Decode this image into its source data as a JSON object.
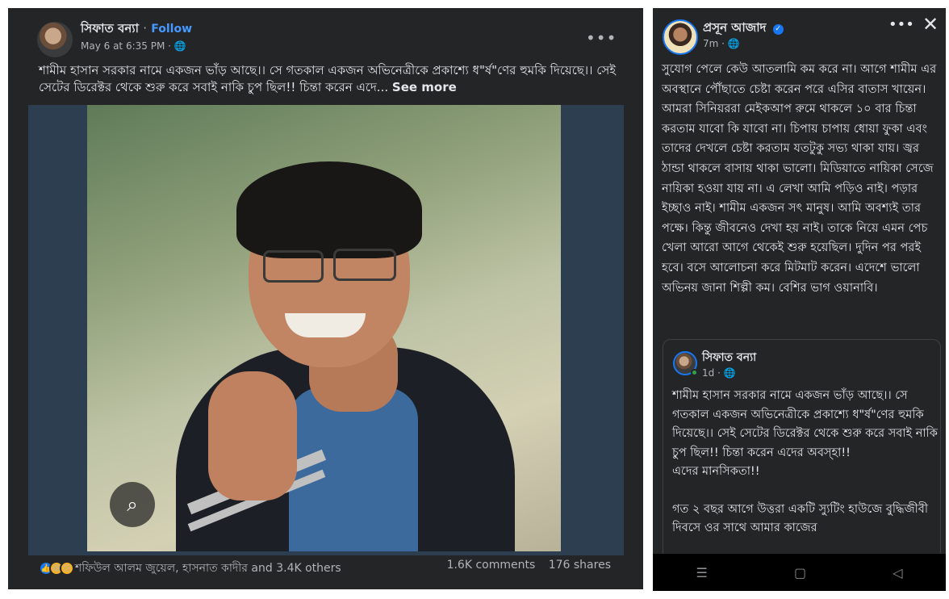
{
  "left_post": {
    "author": "সিফাত বন্যা",
    "separator": "·",
    "follow_label": "Follow",
    "timestamp": "May 6 at 6:35 PM",
    "audience_icon": "globe-icon",
    "menu_icon": "more-dots-icon",
    "menu_glyph": "•••",
    "text": "শামীম হাসান সরকার নামে একজন ভাঁড় আছে।। সে গতকাল একজন অভিনেত্রীকে প্রকাশ্যে ধ\"র্ষ\"ণের হুমকি দিয়েছে।। সেই সেটের ডিরেক্টর থেকে শুরু করে সবাই নাকি চুপ ছিল!! চিন্তা করেন এদে...",
    "see_more_label": "See more",
    "lens_icon": "lens-icon",
    "reaction_icons": [
      "like-icon",
      "haha-icon",
      "sad-icon"
    ],
    "reactions_text": "শফিউল আলম জুয়েল, হাসনাত কাদীর and 3.4K others",
    "comments_text": "1.6K comments",
    "shares_text": "176 shares"
  },
  "right_post": {
    "author": "প্রসূন আজাদ",
    "verified_icon": "verified-badge-icon",
    "timestamp": "7m",
    "menu_glyph": "•••",
    "close_glyph": "✕",
    "text": "সুযোগ পেলে কেউ আতলামি কম করে না। আগে শামীম এর অবস্থানে পৌঁছাতে চেষ্টা করেন পরে এসির বাতাস খায়েন। আমরা সিনিয়ররা মেইকআপ রুমে থাকলে ১০ বার চিন্তা করতাম যাবো কি যাবো না। চিপায় চাপায় ধোয়া ফুকা এবং তাদের দেখলে চেষ্টা করতাম যতটুকু সভ্য থাকা যায়। জ্বর ঠান্ডা থাকলে বাসায় থাকা ভালো। মিডিয়াতে নায়িকা সেজে নায়িকা হওয়া যায় না। এ লেখা আমি পড়িও নাই। পড়ার ইচ্ছাও নাই। শামীম একজন সৎ মানুষ। আমি অবশ্যই তার পক্ষে। কিন্তু জীবনেও দেখা হয় নাই। তাকে নিয়ে এমন পেচ খেলা আরো আগে থেকেই শুরু হয়েছিল। দুদিন পর পরই হবে। বসে আলোচনা করে মিটমাট করেন। এদেশে ভালো অভিনয় জানা শিল্পী কম। বেশির ভাগ ওয়ানাবি।",
    "shared": {
      "author": "সিফাত বন্যা",
      "timestamp": "1d",
      "line1": "শামীম হাসান সরকার নামে একজন ভাঁড় আছে।। সে গতকাল একজন অভিনেত্রীকে প্রকাশ্যে ধ\"র্ষ\"ণের হুমকি দিয়েছে।। সেই সেটের ডিরেক্টর থেকে শুরু করে সবাই নাকি চুপ ছিল!! চিন্তা করেন এদের অবস্হা!!",
      "line2": "এদের মানসিকতা!!",
      "line3": "গত ২ বছর আগে উত্তরা একটি স্যুটিং হাউজে বুদ্ধিজীবী দিবসে ওর সাথে আমার কাজের"
    },
    "nav_icons": [
      "recent-apps-icon",
      "home-icon",
      "back-icon"
    ],
    "nav_glyphs": [
      "☰",
      "▢",
      "◁"
    ]
  }
}
